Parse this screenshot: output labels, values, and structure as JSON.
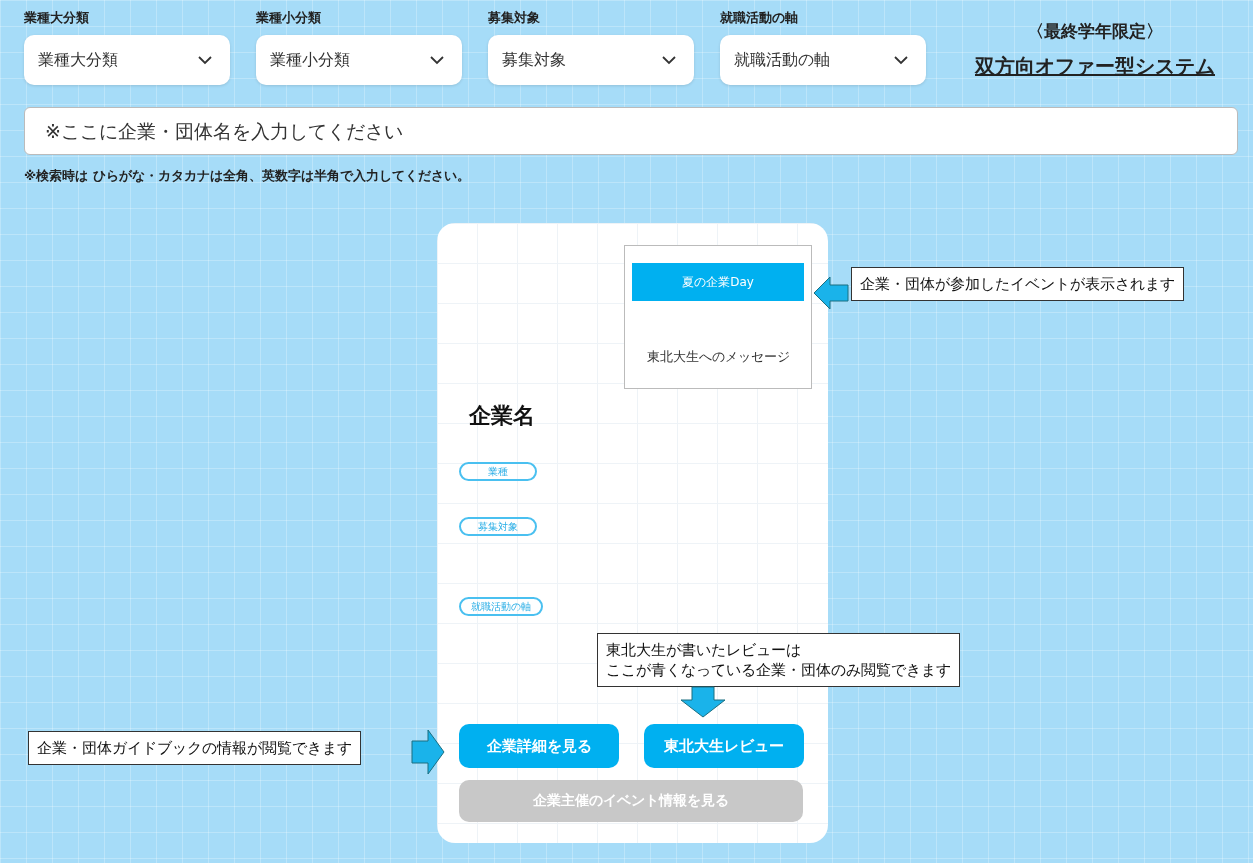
{
  "filters": [
    {
      "label": "業種大分類",
      "value": "業種大分類"
    },
    {
      "label": "業種小分類",
      "value": "業種小分類"
    },
    {
      "label": "募集対象",
      "value": "募集対象"
    },
    {
      "label": "就職活動の軸",
      "value": "就職活動の軸"
    }
  ],
  "header": {
    "notice": "〈最終学年限定〉",
    "title": "双方向オファー型システム"
  },
  "search": {
    "placeholder": "※ここに企業・団体名を入力してください"
  },
  "search_note": "※検索時は ひらがな・カタカナは全角、英数字は半角で入力してください。",
  "card": {
    "event_tag": "夏の企業Day",
    "message": "東北大生へのメッセージ",
    "company_name": "企業名",
    "tags": [
      {
        "label": "業種"
      },
      {
        "label": "募集対象"
      },
      {
        "label": "就職活動の軸"
      }
    ],
    "buttons": [
      {
        "label": "企業詳細を見る",
        "disabled": false
      },
      {
        "label": "東北大生レビュー",
        "disabled": false
      },
      {
        "label": "企業主催のイベント情報を見る",
        "disabled": true
      }
    ]
  },
  "callouts": [
    {
      "kind": "left",
      "lines": [
        "企業・団体が参加したイベントが表示されます"
      ]
    },
    {
      "kind": "down",
      "lines": [
        "東北大生が書いたレビューは",
        "ここが青くなっている企業・団体のみ閲覧できます"
      ]
    },
    {
      "kind": "right",
      "lines": [
        "企業・団体ガイドブックの情報が閲覧できます"
      ]
    }
  ]
}
